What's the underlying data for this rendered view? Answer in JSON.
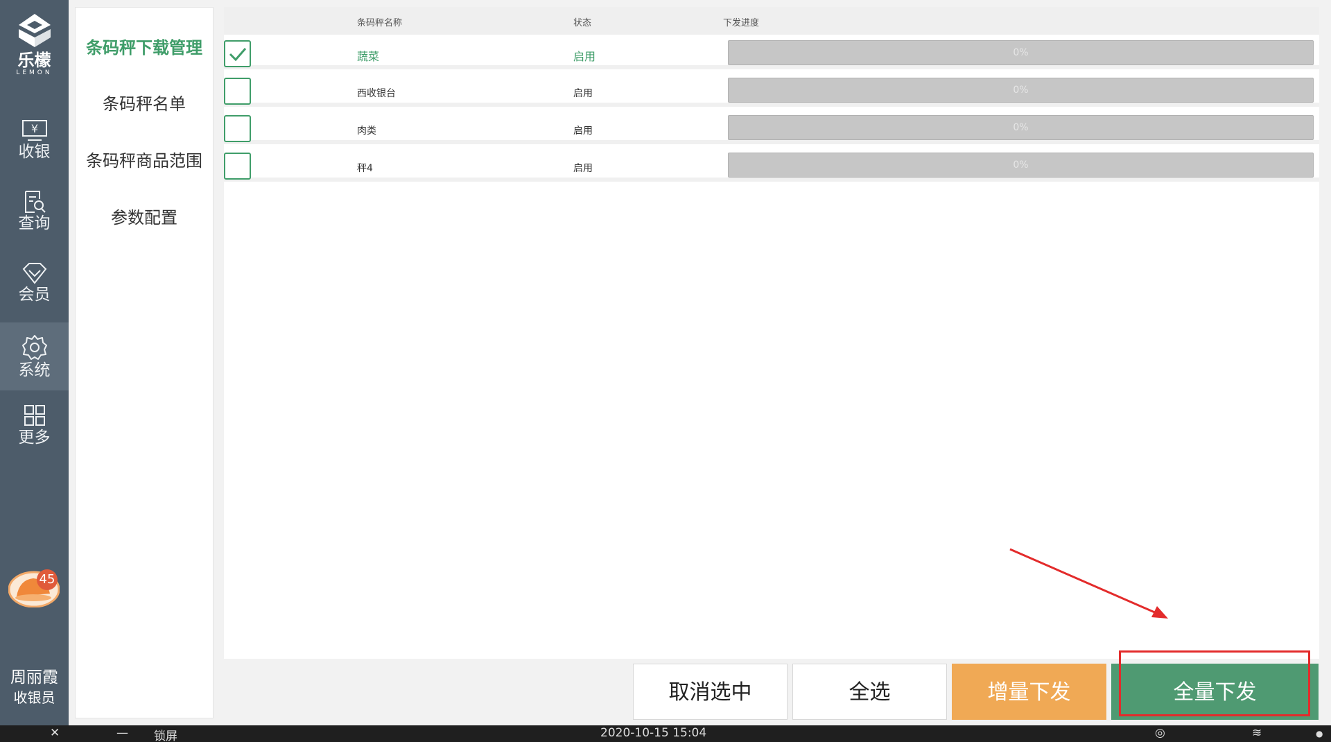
{
  "brand": {
    "name": "乐檬",
    "sub": "LEMON"
  },
  "nav": [
    {
      "label": "收银",
      "icon": "cashier-icon"
    },
    {
      "label": "查询",
      "icon": "search-doc-icon"
    },
    {
      "label": "会员",
      "icon": "member-diamond-icon"
    },
    {
      "label": "系统",
      "icon": "gear-icon",
      "active": true
    },
    {
      "label": "更多",
      "icon": "grid-icon"
    }
  ],
  "notification_count": "45",
  "user": {
    "name": "周丽霞",
    "role": "收银员"
  },
  "submenu": [
    {
      "label": "条码秤下载管理",
      "active": true
    },
    {
      "label": "条码秤名单"
    },
    {
      "label": "条码秤商品范围"
    },
    {
      "label": "参数配置"
    }
  ],
  "table": {
    "headers": {
      "name": "条码秤名称",
      "status": "状态",
      "progress": "下发进度"
    },
    "rows": [
      {
        "name": "蔬菜",
        "status": "启用",
        "progress": "0%",
        "checked": true
      },
      {
        "name": "西收银台",
        "status": "启用",
        "progress": "0%",
        "checked": false
      },
      {
        "name": "肉类",
        "status": "启用",
        "progress": "0%",
        "checked": false
      },
      {
        "name": "秤4",
        "status": "启用",
        "progress": "0%",
        "checked": false
      }
    ]
  },
  "buttons": {
    "deselect": "取消选中",
    "select_all": "全选",
    "incremental": "增量下发",
    "full": "全量下发"
  },
  "statusbar": {
    "lock": "锁屏",
    "datetime": "2020-10-15 15:04"
  },
  "colors": {
    "accent": "#3f9d69",
    "orange": "#f0a955",
    "nav_bg": "#4d5c6a",
    "highlight": "#e32b2b"
  }
}
